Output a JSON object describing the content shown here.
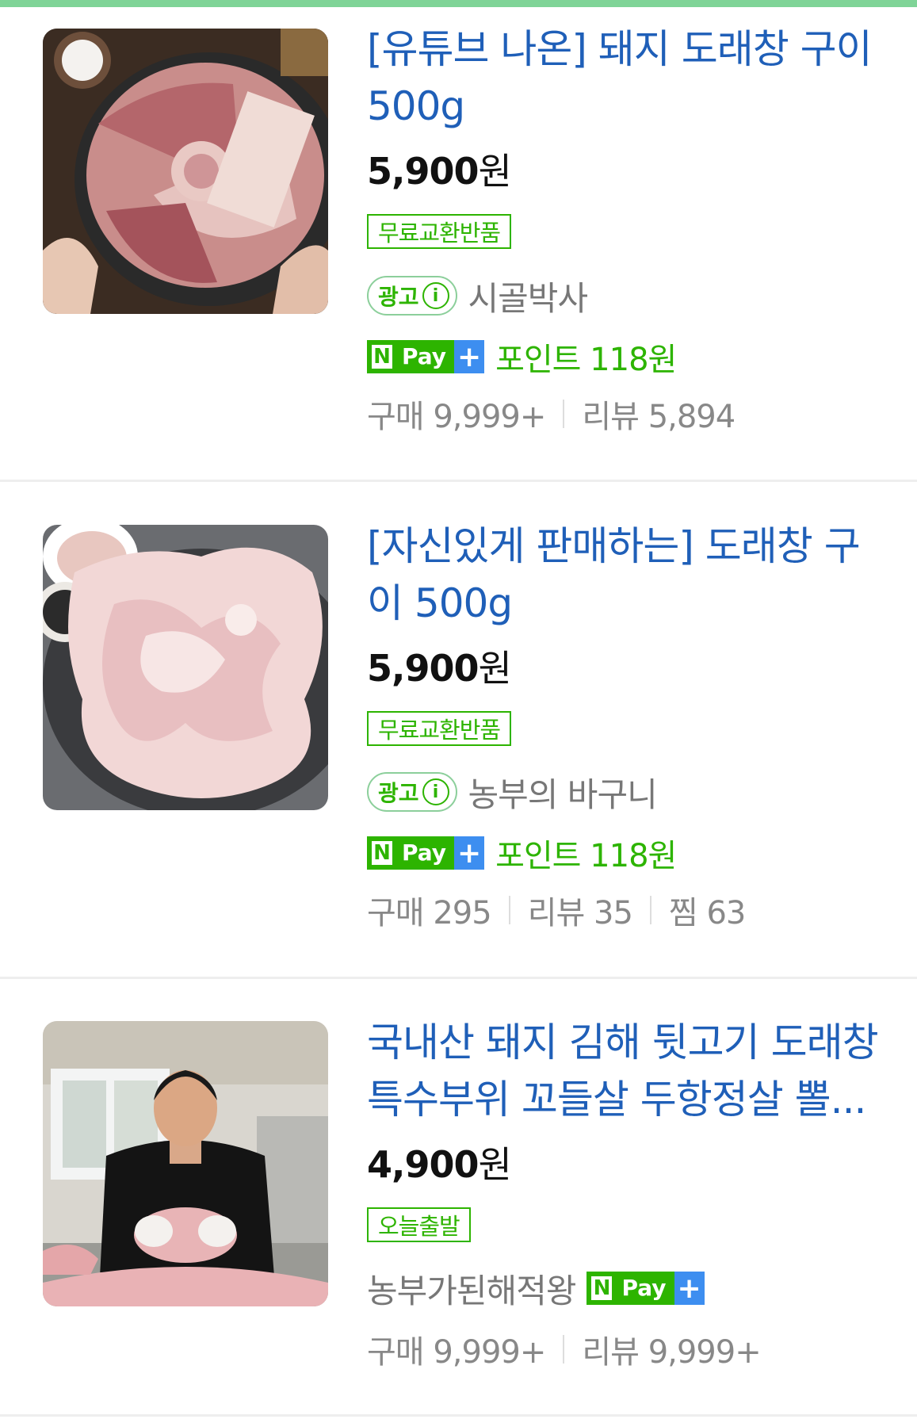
{
  "products": [
    {
      "title": "[유튜브 나온] 돼지 도래창 구이 500g",
      "price_value": "5,900",
      "price_unit": "원",
      "badge": "무료교환반품",
      "ad_label": "광고",
      "ad_info_glyph": "i",
      "seller": "시골박사",
      "npay": {
        "n": "N",
        "pay": "Pay",
        "plus": "+"
      },
      "points": "포인트 118원",
      "stats": [
        {
          "label": "구매",
          "value": "9,999+"
        },
        {
          "label": "리뷰",
          "value": "5,894"
        }
      ]
    },
    {
      "title": "[자신있게 판매하는] 도래창 구이 500g",
      "price_value": "5,900",
      "price_unit": "원",
      "badge": "무료교환반품",
      "ad_label": "광고",
      "ad_info_glyph": "i",
      "seller": "농부의 바구니",
      "npay": {
        "n": "N",
        "pay": "Pay",
        "plus": "+"
      },
      "points": "포인트 118원",
      "stats": [
        {
          "label": "구매",
          "value": "295"
        },
        {
          "label": "리뷰",
          "value": "35"
        },
        {
          "label": "찜",
          "value": "63"
        }
      ]
    },
    {
      "title": "국내산 돼지 김해 뒷고기 도래창 특수부위 꼬들살 두항정살 뽈...",
      "price_value": "4,900",
      "price_unit": "원",
      "badge": "오늘출발",
      "seller": "농부가된해적왕",
      "npay": {
        "n": "N",
        "pay": "Pay",
        "plus": "+"
      },
      "stats": [
        {
          "label": "구매",
          "value": "9,999+"
        },
        {
          "label": "리뷰",
          "value": "9,999+"
        }
      ]
    }
  ],
  "colors": {
    "title": "#1f5fb8",
    "accent_green": "#2db400",
    "npay_plus_blue": "#3d8ef0",
    "meta_gray": "#888888"
  }
}
